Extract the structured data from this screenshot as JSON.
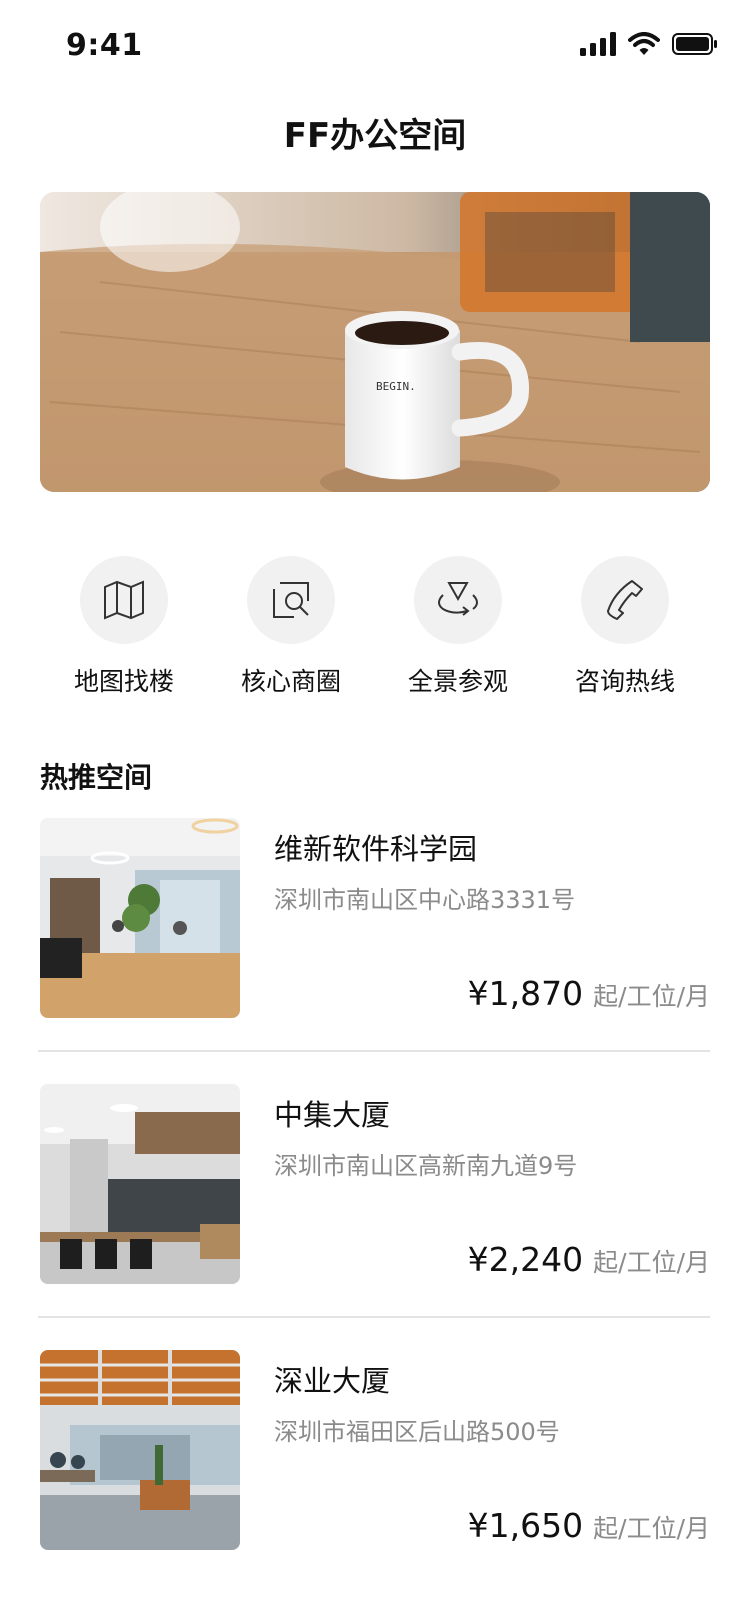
{
  "status_bar": {
    "time": "9:41",
    "icons": [
      "signal-icon",
      "wifi-icon",
      "battery-icon"
    ]
  },
  "header": {
    "title": "FF办公空间"
  },
  "banner": {
    "mug_text": "BEGIN."
  },
  "quick_actions": [
    {
      "label": "地图找楼",
      "icon": "map-icon"
    },
    {
      "label": "核心商圈",
      "icon": "search-area-icon"
    },
    {
      "label": "全景参观",
      "icon": "panorama-icon"
    },
    {
      "label": "咨询热线",
      "icon": "phone-icon"
    }
  ],
  "section": {
    "title": "热推空间"
  },
  "listings": [
    {
      "name": "维新软件科学园",
      "address": "深圳市南山区中心路3331号",
      "price": "¥1,870",
      "unit": "起/工位/月"
    },
    {
      "name": "中集大厦",
      "address": "深圳市南山区高新南九道9号",
      "price": "¥2,240",
      "unit": "起/工位/月"
    },
    {
      "name": "深业大厦",
      "address": "深圳市福田区后山路500号",
      "price": "¥1,650",
      "unit": "起/工位/月"
    }
  ],
  "colors": {
    "icon_circle": "#f1f1f1",
    "secondary_text": "#8b8b8b",
    "divider": "#e3e3e3"
  }
}
